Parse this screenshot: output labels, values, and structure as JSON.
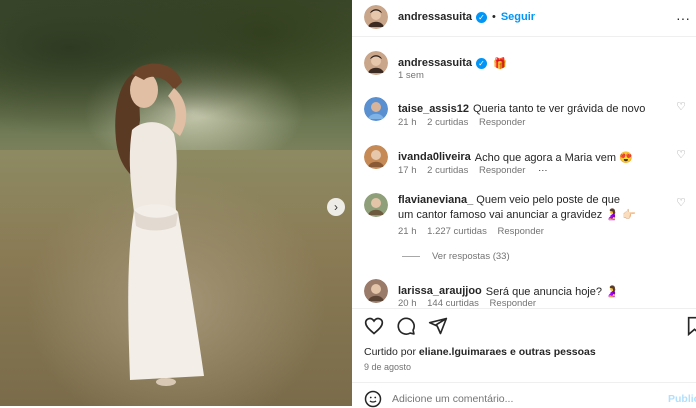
{
  "post": {
    "username": "andressasuita",
    "follow_label": "Seguir",
    "separator": "•",
    "caption_emoji": "🎁",
    "caption_time": "1 sem"
  },
  "comments": [
    {
      "user": "taise_assis12",
      "text": "Queria tanto te ver grávida de novo",
      "time": "21 h",
      "likes": "2 curtidas",
      "reply": "Responder",
      "avatar_color": "#5a8fd0"
    },
    {
      "user": "ivanda0liveira",
      "text": "Acho que agora a Maria vem 😍",
      "time": "17 h",
      "likes": "2 curtidas",
      "reply": "Responder",
      "more": "···",
      "avatar_color": "#c58a56"
    },
    {
      "user": "flavianeviana_",
      "text": "Quem veio pelo poste de que um cantor famoso vai anunciar a gravidez 🤰 👉🏻",
      "time": "21 h",
      "likes": "1.227 curtidas",
      "reply": "Responder",
      "view_replies": "Ver respostas (33)",
      "avatar_color": "#8f9f7a"
    },
    {
      "user": "larissa_araujjoo",
      "text": "Será que anuncia hoje? 🤰",
      "time": "20 h",
      "likes": "144 curtidas",
      "reply": "Responder",
      "avatar_color": "#9a7a68"
    }
  ],
  "actions": {
    "liked_by_prefix": "Curtido por",
    "liked_by_user": "eliane.lguimaraes",
    "liked_by_suffix": "e outras pessoas",
    "date": "9 de agosto",
    "comment_placeholder": "Adicione um comentário...",
    "publish_label": "Publicar"
  },
  "colors": {
    "accent": "#0095f6",
    "muted": "#737373"
  }
}
